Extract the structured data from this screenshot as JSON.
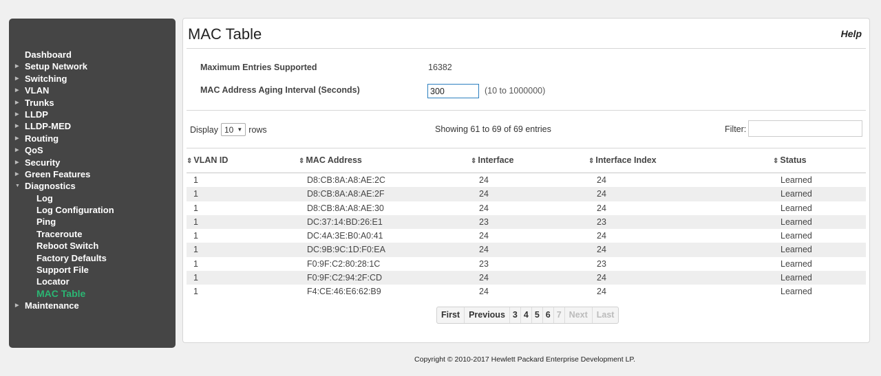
{
  "sidebar": {
    "items": [
      {
        "label": "Dashboard",
        "arrow": "",
        "sub": false,
        "active": false
      },
      {
        "label": "Setup Network",
        "arrow": "▶",
        "sub": false,
        "active": false
      },
      {
        "label": "Switching",
        "arrow": "▶",
        "sub": false,
        "active": false
      },
      {
        "label": "VLAN",
        "arrow": "▶",
        "sub": false,
        "active": false
      },
      {
        "label": "Trunks",
        "arrow": "▶",
        "sub": false,
        "active": false
      },
      {
        "label": "LLDP",
        "arrow": "▶",
        "sub": false,
        "active": false
      },
      {
        "label": "LLDP-MED",
        "arrow": "▶",
        "sub": false,
        "active": false
      },
      {
        "label": "Routing",
        "arrow": "▶",
        "sub": false,
        "active": false
      },
      {
        "label": "QoS",
        "arrow": "▶",
        "sub": false,
        "active": false
      },
      {
        "label": "Security",
        "arrow": "▶",
        "sub": false,
        "active": false
      },
      {
        "label": "Green Features",
        "arrow": "▶",
        "sub": false,
        "active": false
      },
      {
        "label": "Diagnostics",
        "arrow": "▼",
        "sub": false,
        "active": false
      },
      {
        "label": "Log",
        "arrow": "",
        "sub": true,
        "active": false
      },
      {
        "label": "Log Configuration",
        "arrow": "",
        "sub": true,
        "active": false
      },
      {
        "label": "Ping",
        "arrow": "",
        "sub": true,
        "active": false
      },
      {
        "label": "Traceroute",
        "arrow": "",
        "sub": true,
        "active": false
      },
      {
        "label": "Reboot Switch",
        "arrow": "",
        "sub": true,
        "active": false
      },
      {
        "label": "Factory Defaults",
        "arrow": "",
        "sub": true,
        "active": false
      },
      {
        "label": "Support File",
        "arrow": "",
        "sub": true,
        "active": false
      },
      {
        "label": "Locator",
        "arrow": "",
        "sub": true,
        "active": false
      },
      {
        "label": "MAC Table",
        "arrow": "",
        "sub": true,
        "active": true
      },
      {
        "label": "Maintenance",
        "arrow": "▶",
        "sub": false,
        "active": false
      }
    ]
  },
  "header": {
    "title": "MAC Table",
    "help_label": "Help"
  },
  "settings": {
    "max_entries_label": "Maximum Entries Supported",
    "max_entries_value": "16382",
    "aging_label": "MAC Address Aging Interval  (Seconds)",
    "aging_value": "300",
    "aging_range": "(10 to 1000000)"
  },
  "table_controls": {
    "display_label": "Display",
    "display_value": "10",
    "rows_label": "rows",
    "showing_text": "Showing 61 to 69 of 69 entries",
    "filter_label": "Filter:"
  },
  "table": {
    "columns": [
      "VLAN ID",
      "MAC Address",
      "Interface",
      "Interface Index",
      "Status"
    ],
    "sort_icon": "⇕",
    "rows": [
      [
        "1",
        "D8:CB:8A:A8:AE:2C",
        "24",
        "24",
        "Learned"
      ],
      [
        "1",
        "D8:CB:8A:A8:AE:2F",
        "24",
        "24",
        "Learned"
      ],
      [
        "1",
        "D8:CB:8A:A8:AE:30",
        "24",
        "24",
        "Learned"
      ],
      [
        "1",
        "DC:37:14:BD:26:E1",
        "23",
        "23",
        "Learned"
      ],
      [
        "1",
        "DC:4A:3E:B0:A0:41",
        "24",
        "24",
        "Learned"
      ],
      [
        "1",
        "DC:9B:9C:1D:F0:EA",
        "24",
        "24",
        "Learned"
      ],
      [
        "1",
        "F0:9F:C2:80:28:1C",
        "23",
        "23",
        "Learned"
      ],
      [
        "1",
        "F0:9F:C2:94:2F:CD",
        "24",
        "24",
        "Learned"
      ],
      [
        "1",
        "F4:CE:46:E6:62:B9",
        "24",
        "24",
        "Learned"
      ]
    ]
  },
  "pagination": {
    "items": [
      {
        "label": "First",
        "disabled": false,
        "num": false
      },
      {
        "label": "Previous",
        "disabled": false,
        "num": false
      },
      {
        "label": "3",
        "disabled": false,
        "num": true
      },
      {
        "label": "4",
        "disabled": false,
        "num": true
      },
      {
        "label": "5",
        "disabled": false,
        "num": true
      },
      {
        "label": "6",
        "disabled": false,
        "num": true
      },
      {
        "label": "7",
        "disabled": true,
        "num": true
      },
      {
        "label": "Next",
        "disabled": true,
        "num": false
      },
      {
        "label": "Last",
        "disabled": true,
        "num": false
      }
    ]
  },
  "footer": {
    "copyright": "Copyright © 2010-2017 Hewlett Packard Enterprise Development LP."
  },
  "colors": {
    "sidebar_bg": "#454545",
    "active_nav": "#2bb673",
    "input_border": "#2b7fbf"
  }
}
